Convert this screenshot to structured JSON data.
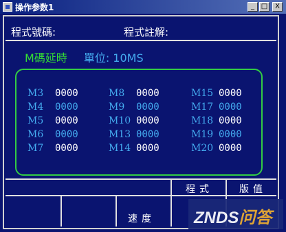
{
  "window": {
    "title": "操作参数1",
    "min_label": "_",
    "max_label": "□",
    "close_label": "X"
  },
  "header": {
    "program_no_label": "程式號碼:",
    "program_note_label": "程式註解:"
  },
  "section": {
    "title": "M碼延時",
    "unit": "單位: 10MS"
  },
  "rows": [
    {
      "c1": {
        "label": "M3",
        "value": "0000"
      },
      "c2": {
        "label": "M8",
        "value": "0000"
      },
      "c3": {
        "label": "M15",
        "value": "0000"
      }
    },
    {
      "c1": {
        "label": "M4",
        "value": "0000"
      },
      "c2": {
        "label": "M9",
        "value": "0000"
      },
      "c3": {
        "label": "M17",
        "value": "0000"
      }
    },
    {
      "c1": {
        "label": "M5",
        "value": "0000"
      },
      "c2": {
        "label": "M10",
        "value": "0000"
      },
      "c3": {
        "label": "M18",
        "value": "0000"
      }
    },
    {
      "c1": {
        "label": "M6",
        "value": "0000"
      },
      "c2": {
        "label": "M13",
        "value": "0000"
      },
      "c3": {
        "label": "M19",
        "value": "0000"
      }
    },
    {
      "c1": {
        "label": "M7",
        "value": "0000"
      },
      "c2": {
        "label": "M14",
        "value": "0000"
      },
      "c3": {
        "label": "M20",
        "value": "0000"
      }
    }
  ],
  "value_colors": [
    "#ffffff",
    "#44aaee",
    "#ffffff",
    "#44aaee",
    "#ffffff"
  ],
  "bottom": {
    "program_label": "程式",
    "version_label": "版值",
    "speed_label": "速度"
  },
  "watermark": {
    "brand": "ZNDS",
    "suffix": "问答"
  }
}
